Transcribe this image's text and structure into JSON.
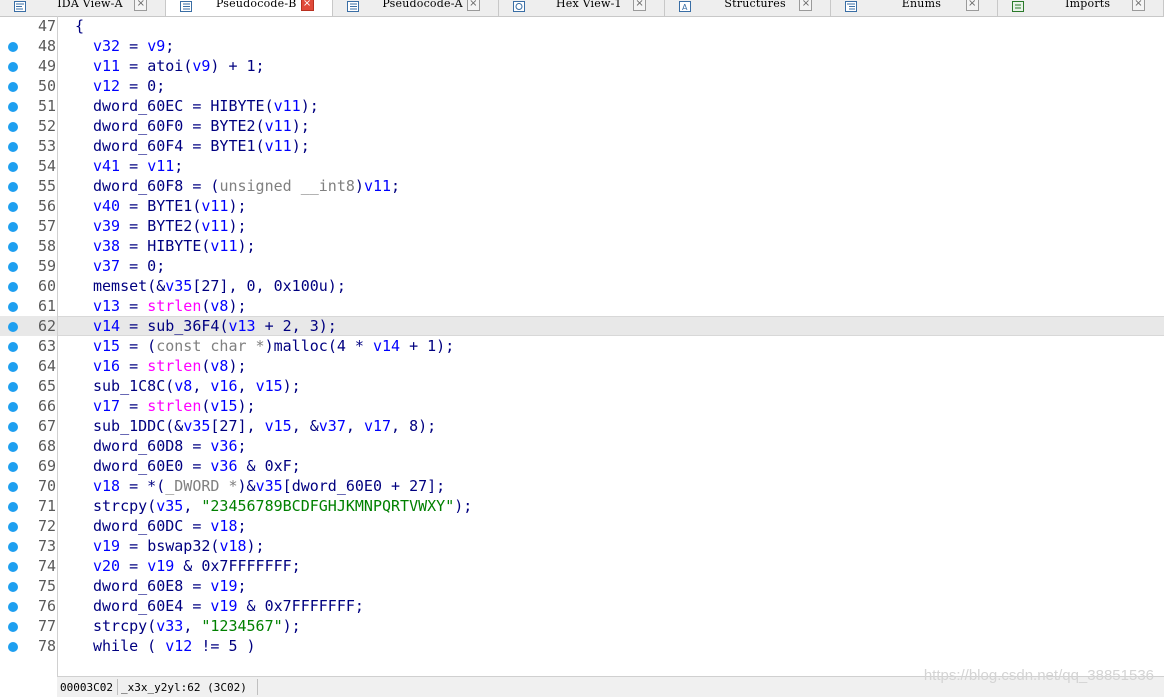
{
  "tabs": [
    {
      "label": "IDA View-A",
      "icon": "disassembly-view-icon",
      "active": false
    },
    {
      "label": "Pseudocode-B",
      "icon": "pseudocode-icon",
      "active": true
    },
    {
      "label": "Pseudocode-A",
      "icon": "pseudocode-icon",
      "active": false
    },
    {
      "label": "Hex View-1",
      "icon": "hex-view-icon",
      "active": false
    },
    {
      "label": "Structures",
      "icon": "structures-icon",
      "active": false
    },
    {
      "label": "Enums",
      "icon": "enums-icon",
      "active": false
    },
    {
      "label": "Imports",
      "icon": "imports-icon",
      "active": false
    }
  ],
  "code": {
    "highlighted_line": "62",
    "lines": [
      {
        "n": "47",
        "dot": false,
        "tokens": [
          [
            "p",
            "{"
          ]
        ],
        "indent": 0
      },
      {
        "n": "48",
        "dot": true,
        "tokens": [
          [
            "v",
            "v32"
          ],
          [
            "p",
            " = "
          ],
          [
            "v",
            "v9"
          ],
          [
            "p",
            ";"
          ]
        ],
        "indent": 1
      },
      {
        "n": "49",
        "dot": true,
        "tokens": [
          [
            "v",
            "v11"
          ],
          [
            "p",
            " = "
          ],
          [
            "f",
            "atoi"
          ],
          [
            "p",
            "("
          ],
          [
            "v",
            "v9"
          ],
          [
            "p",
            ") + 1;"
          ]
        ],
        "indent": 1
      },
      {
        "n": "50",
        "dot": true,
        "tokens": [
          [
            "v",
            "v12"
          ],
          [
            "p",
            " = 0;"
          ]
        ],
        "indent": 1
      },
      {
        "n": "51",
        "dot": true,
        "tokens": [
          [
            "f",
            "dword_60EC"
          ],
          [
            "p",
            " = "
          ],
          [
            "f",
            "HIBYTE"
          ],
          [
            "p",
            "("
          ],
          [
            "v",
            "v11"
          ],
          [
            "p",
            ");"
          ]
        ],
        "indent": 1
      },
      {
        "n": "52",
        "dot": true,
        "tokens": [
          [
            "f",
            "dword_60F0"
          ],
          [
            "p",
            " = "
          ],
          [
            "f",
            "BYTE2"
          ],
          [
            "p",
            "("
          ],
          [
            "v",
            "v11"
          ],
          [
            "p",
            ");"
          ]
        ],
        "indent": 1
      },
      {
        "n": "53",
        "dot": true,
        "tokens": [
          [
            "f",
            "dword_60F4"
          ],
          [
            "p",
            " = "
          ],
          [
            "f",
            "BYTE1"
          ],
          [
            "p",
            "("
          ],
          [
            "v",
            "v11"
          ],
          [
            "p",
            ");"
          ]
        ],
        "indent": 1
      },
      {
        "n": "54",
        "dot": true,
        "tokens": [
          [
            "v",
            "v41"
          ],
          [
            "p",
            " = "
          ],
          [
            "v",
            "v11"
          ],
          [
            "p",
            ";"
          ]
        ],
        "indent": 1
      },
      {
        "n": "55",
        "dot": true,
        "tokens": [
          [
            "f",
            "dword_60F8"
          ],
          [
            "p",
            " = ("
          ],
          [
            "t",
            "unsigned __int8"
          ],
          [
            "p",
            ")"
          ],
          [
            "v",
            "v11"
          ],
          [
            "p",
            ";"
          ]
        ],
        "indent": 1
      },
      {
        "n": "56",
        "dot": true,
        "tokens": [
          [
            "v",
            "v40"
          ],
          [
            "p",
            " = "
          ],
          [
            "f",
            "BYTE1"
          ],
          [
            "p",
            "("
          ],
          [
            "v",
            "v11"
          ],
          [
            "p",
            ");"
          ]
        ],
        "indent": 1
      },
      {
        "n": "57",
        "dot": true,
        "tokens": [
          [
            "v",
            "v39"
          ],
          [
            "p",
            " = "
          ],
          [
            "f",
            "BYTE2"
          ],
          [
            "p",
            "("
          ],
          [
            "v",
            "v11"
          ],
          [
            "p",
            ");"
          ]
        ],
        "indent": 1
      },
      {
        "n": "58",
        "dot": true,
        "tokens": [
          [
            "v",
            "v38"
          ],
          [
            "p",
            " = "
          ],
          [
            "f",
            "HIBYTE"
          ],
          [
            "p",
            "("
          ],
          [
            "v",
            "v11"
          ],
          [
            "p",
            ");"
          ]
        ],
        "indent": 1
      },
      {
        "n": "59",
        "dot": true,
        "tokens": [
          [
            "v",
            "v37"
          ],
          [
            "p",
            " = 0;"
          ]
        ],
        "indent": 1
      },
      {
        "n": "60",
        "dot": true,
        "tokens": [
          [
            "f",
            "memset"
          ],
          [
            "p",
            "(&"
          ],
          [
            "v",
            "v35"
          ],
          [
            "p",
            "[27], 0, 0x100u);"
          ]
        ],
        "indent": 1
      },
      {
        "n": "61",
        "dot": true,
        "tokens": [
          [
            "v",
            "v13"
          ],
          [
            "p",
            " = "
          ],
          [
            "m",
            "strlen"
          ],
          [
            "p",
            "("
          ],
          [
            "v",
            "v8"
          ],
          [
            "p",
            ");"
          ]
        ],
        "indent": 1
      },
      {
        "n": "62",
        "dot": true,
        "tokens": [
          [
            "v",
            "v14"
          ],
          [
            "p",
            " = "
          ],
          [
            "f",
            "sub_36F4"
          ],
          [
            "p",
            "("
          ],
          [
            "v",
            "v13"
          ],
          [
            "p",
            " + 2, 3);"
          ]
        ],
        "indent": 1
      },
      {
        "n": "63",
        "dot": true,
        "tokens": [
          [
            "v",
            "v15"
          ],
          [
            "p",
            " = ("
          ],
          [
            "t",
            "const char *"
          ],
          [
            "p",
            ")"
          ],
          [
            "f",
            "malloc"
          ],
          [
            "p",
            "(4 * "
          ],
          [
            "v",
            "v14"
          ],
          [
            "p",
            " + 1);"
          ]
        ],
        "indent": 1
      },
      {
        "n": "64",
        "dot": true,
        "tokens": [
          [
            "v",
            "v16"
          ],
          [
            "p",
            " = "
          ],
          [
            "m",
            "strlen"
          ],
          [
            "p",
            "("
          ],
          [
            "v",
            "v8"
          ],
          [
            "p",
            ");"
          ]
        ],
        "indent": 1
      },
      {
        "n": "65",
        "dot": true,
        "tokens": [
          [
            "f",
            "sub_1C8C"
          ],
          [
            "p",
            "("
          ],
          [
            "v",
            "v8"
          ],
          [
            "p",
            ", "
          ],
          [
            "v",
            "v16"
          ],
          [
            "p",
            ", "
          ],
          [
            "v",
            "v15"
          ],
          [
            "p",
            ");"
          ]
        ],
        "indent": 1
      },
      {
        "n": "66",
        "dot": true,
        "tokens": [
          [
            "v",
            "v17"
          ],
          [
            "p",
            " = "
          ],
          [
            "m",
            "strlen"
          ],
          [
            "p",
            "("
          ],
          [
            "v",
            "v15"
          ],
          [
            "p",
            ");"
          ]
        ],
        "indent": 1
      },
      {
        "n": "67",
        "dot": true,
        "tokens": [
          [
            "f",
            "sub_1DDC"
          ],
          [
            "p",
            "(&"
          ],
          [
            "v",
            "v35"
          ],
          [
            "p",
            "[27], "
          ],
          [
            "v",
            "v15"
          ],
          [
            "p",
            ", &"
          ],
          [
            "v",
            "v37"
          ],
          [
            "p",
            ", "
          ],
          [
            "v",
            "v17"
          ],
          [
            "p",
            ", 8);"
          ]
        ],
        "indent": 1
      },
      {
        "n": "68",
        "dot": true,
        "tokens": [
          [
            "f",
            "dword_60D8"
          ],
          [
            "p",
            " = "
          ],
          [
            "v",
            "v36"
          ],
          [
            "p",
            ";"
          ]
        ],
        "indent": 1
      },
      {
        "n": "69",
        "dot": true,
        "tokens": [
          [
            "f",
            "dword_60E0"
          ],
          [
            "p",
            " = "
          ],
          [
            "v",
            "v36"
          ],
          [
            "p",
            " & 0xF;"
          ]
        ],
        "indent": 1
      },
      {
        "n": "70",
        "dot": true,
        "tokens": [
          [
            "v",
            "v18"
          ],
          [
            "p",
            " = *("
          ],
          [
            "t",
            "_DWORD *"
          ],
          [
            "p",
            ")&"
          ],
          [
            "v",
            "v35"
          ],
          [
            "p",
            "["
          ],
          [
            "f",
            "dword_60E0"
          ],
          [
            "p",
            " + 27];"
          ]
        ],
        "indent": 1
      },
      {
        "n": "71",
        "dot": true,
        "tokens": [
          [
            "f",
            "strcpy"
          ],
          [
            "p",
            "("
          ],
          [
            "v",
            "v35"
          ],
          [
            "p",
            ", "
          ],
          [
            "s",
            "\"23456789BCDFGHJKMNPQRTVWXY\""
          ],
          [
            "p",
            ");"
          ]
        ],
        "indent": 1
      },
      {
        "n": "72",
        "dot": true,
        "tokens": [
          [
            "f",
            "dword_60DC"
          ],
          [
            "p",
            " = "
          ],
          [
            "v",
            "v18"
          ],
          [
            "p",
            ";"
          ]
        ],
        "indent": 1
      },
      {
        "n": "73",
        "dot": true,
        "tokens": [
          [
            "v",
            "v19"
          ],
          [
            "p",
            " = "
          ],
          [
            "f",
            "bswap32"
          ],
          [
            "p",
            "("
          ],
          [
            "v",
            "v18"
          ],
          [
            "p",
            ");"
          ]
        ],
        "indent": 1
      },
      {
        "n": "74",
        "dot": true,
        "tokens": [
          [
            "v",
            "v20"
          ],
          [
            "p",
            " = "
          ],
          [
            "v",
            "v19"
          ],
          [
            "p",
            " & 0x7FFFFFFF;"
          ]
        ],
        "indent": 1
      },
      {
        "n": "75",
        "dot": true,
        "tokens": [
          [
            "f",
            "dword_60E8"
          ],
          [
            "p",
            " = "
          ],
          [
            "v",
            "v19"
          ],
          [
            "p",
            ";"
          ]
        ],
        "indent": 1
      },
      {
        "n": "76",
        "dot": true,
        "tokens": [
          [
            "f",
            "dword_60E4"
          ],
          [
            "p",
            " = "
          ],
          [
            "v",
            "v19"
          ],
          [
            "p",
            " & 0x7FFFFFFF;"
          ]
        ],
        "indent": 1
      },
      {
        "n": "77",
        "dot": true,
        "tokens": [
          [
            "f",
            "strcpy"
          ],
          [
            "p",
            "("
          ],
          [
            "v",
            "v33"
          ],
          [
            "p",
            ", "
          ],
          [
            "s",
            "\"1234567\""
          ],
          [
            "p",
            ");"
          ]
        ],
        "indent": 1
      },
      {
        "n": "78",
        "dot": true,
        "tokens": [
          [
            "k",
            "while"
          ],
          [
            "p",
            " ( "
          ],
          [
            "v",
            "v12"
          ],
          [
            "p",
            " != 5 )"
          ]
        ],
        "indent": 1
      }
    ]
  },
  "status": {
    "address": "00003C02",
    "location": "_x3x_y2yl:62 (3C02)"
  },
  "watermark": "https://blog.csdn.net/qq_38851536"
}
